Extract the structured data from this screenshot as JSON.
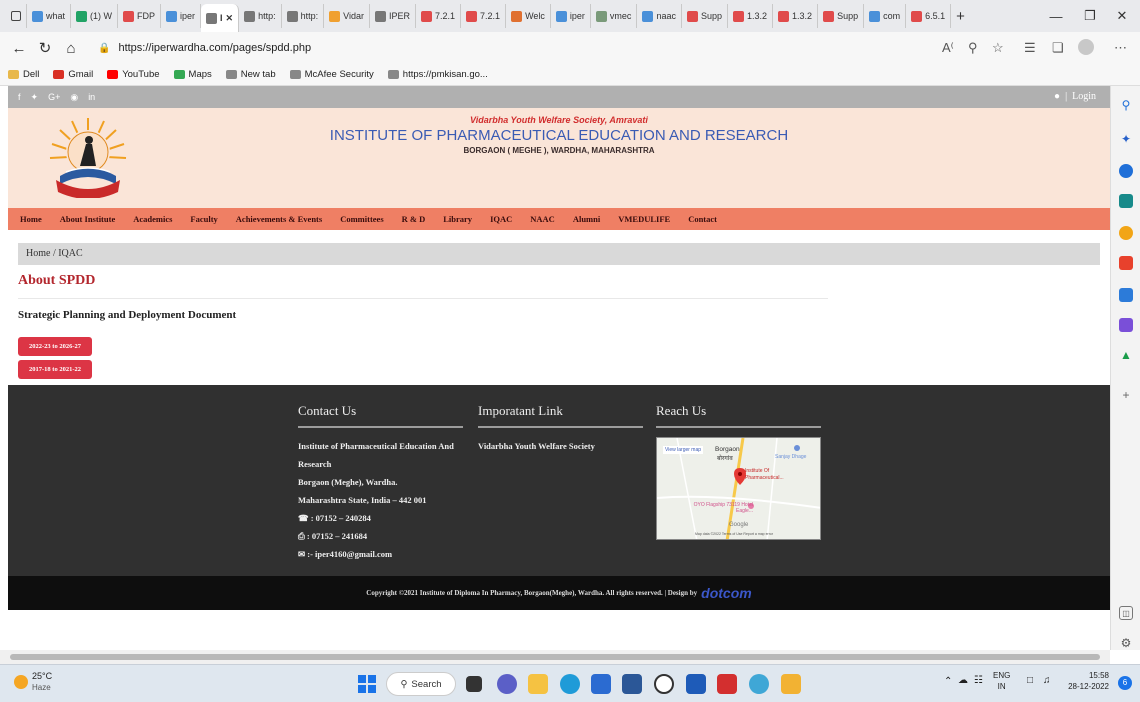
{
  "browser": {
    "tabs": [
      {
        "label": "what",
        "color": "#4a90d9"
      },
      {
        "label": "(1) W",
        "color": "#21a366"
      },
      {
        "label": "FDP",
        "color": "#e04b4b"
      },
      {
        "label": "iper",
        "color": "#4a90d9"
      },
      {
        "label": "I",
        "color": "#777777",
        "active": true
      },
      {
        "label": "http:",
        "color": "#777777"
      },
      {
        "label": "http:",
        "color": "#777777"
      },
      {
        "label": "Vidar",
        "color": "#f0a030"
      },
      {
        "label": "IPER",
        "color": "#777777"
      },
      {
        "label": "7.2.1",
        "color": "#e04b4b"
      },
      {
        "label": "7.2.1",
        "color": "#e04b4b"
      },
      {
        "label": "Welc",
        "color": "#e07030"
      },
      {
        "label": "iper",
        "color": "#4a90d9"
      },
      {
        "label": "vmec",
        "color": "#7a9a7a"
      },
      {
        "label": "naac",
        "color": "#4a90d9"
      },
      {
        "label": "Supp",
        "color": "#e04b4b"
      },
      {
        "label": "1.3.2",
        "color": "#e04b4b"
      },
      {
        "label": "1.3.2",
        "color": "#e04b4b"
      },
      {
        "label": "Supp",
        "color": "#e04b4b"
      },
      {
        "label": "com",
        "color": "#4a90d9"
      },
      {
        "label": "6.5.1",
        "color": "#e04b4b"
      }
    ],
    "url": "https://iperwardha.com/pages/spdd.php",
    "bookmarks": [
      {
        "label": "Dell",
        "color": "#e8b84a"
      },
      {
        "label": "Gmail",
        "color": "#d93025"
      },
      {
        "label": "YouTube",
        "color": "#ff0000"
      },
      {
        "label": "Maps",
        "color": "#34a853"
      },
      {
        "label": "New tab",
        "color": "#888888"
      },
      {
        "label": "McAfee Security",
        "color": "#888888"
      },
      {
        "label": "https://pmkisan.go...",
        "color": "#888888"
      }
    ]
  },
  "site": {
    "login": "Login",
    "society": "Vidarbha Youth Welfare Society, Amravati",
    "institute": "INSTITUTE OF PHARMACEUTICAL EDUCATION AND RESEARCH",
    "address": "BORGAON ( MEGHE ), WARDHA, MAHARASHTRA",
    "nav": [
      "Home",
      "About Institute",
      "Academics",
      "Faculty",
      "Achievements & Events",
      "Committees",
      "R & D",
      "Library",
      "IQAC",
      "NAAC",
      "Alumni",
      "VMEDULIFE",
      "Contact"
    ],
    "breadcrumb": "Home  /  IQAC",
    "page_title": "About SPDD",
    "subtitle": "Strategic Planning and Deployment Document",
    "buttons": [
      "2022-23 to 2026-27",
      "2017-18 to 2021-22"
    ]
  },
  "footer": {
    "contact_title": "Contact Us",
    "contact_lines": [
      "Institute of Pharmaceutical Education And",
      "Research",
      "Borgaon (Meghe), Wardha.",
      "Maharashtra State, India – 442 001",
      "☎ : 07152 – 240284",
      "⎙ : 07152 – 241684",
      "✉ :- iper4160@gmail.com"
    ],
    "links_title": "Imporatant Link",
    "link": "Vidarbha Youth Welfare Society",
    "reach_title": "Reach Us",
    "map": {
      "larger": "View larger map",
      "town": "Borgaon",
      "town_local": "बोरगांव",
      "place1": "Sanjay Dhage",
      "pin": "Institute Of Pharmaceutical...",
      "hotel": "OYO Flagship 73119 Hotel Eagle...",
      "google": "Google",
      "credits": "Map data ©2022  Terms of Use  Report a map error"
    },
    "copyright": "Copyright ©2021 Institute of Diploma In Pharmacy, Borgaon(Meghe), Wardha. All rights reserved. | Design by",
    "designer": "dotcom"
  },
  "taskbar": {
    "temp": "25°C",
    "weather": "Haze",
    "search": "Search",
    "lang_top": "ENG",
    "lang_bottom": "IN",
    "time": "15:58",
    "date": "28-12-2022",
    "notif": "6"
  }
}
